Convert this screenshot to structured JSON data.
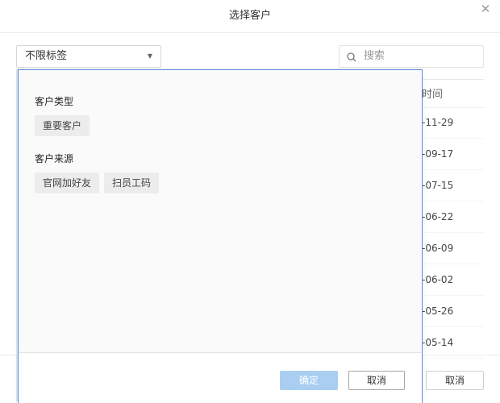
{
  "dialog": {
    "title": "选择客户",
    "close_icon": "close-icon"
  },
  "filter": {
    "selected": "不限标签",
    "caret": "▼"
  },
  "search": {
    "placeholder": "搜索",
    "icon": "search-icon"
  },
  "table": {
    "time_header": "时间",
    "dates": [
      "-11-29",
      "-09-17",
      "-07-15",
      "-06-22",
      "-06-09",
      "-06-02",
      "-05-26",
      "-05-14"
    ]
  },
  "tag_panel": {
    "groups": [
      {
        "title": "客户类型",
        "tags": [
          "重要客户"
        ]
      },
      {
        "title": "客户来源",
        "tags": [
          "官网加好友",
          "扫员工码"
        ]
      }
    ],
    "confirm_label": "确定",
    "cancel_label": "取消"
  },
  "footer": {
    "cancel_label": "取消"
  },
  "colors": {
    "panel_border": "#5b8ed6",
    "confirm_disabled": "#a9cef2",
    "tag_bg": "#ececec"
  }
}
